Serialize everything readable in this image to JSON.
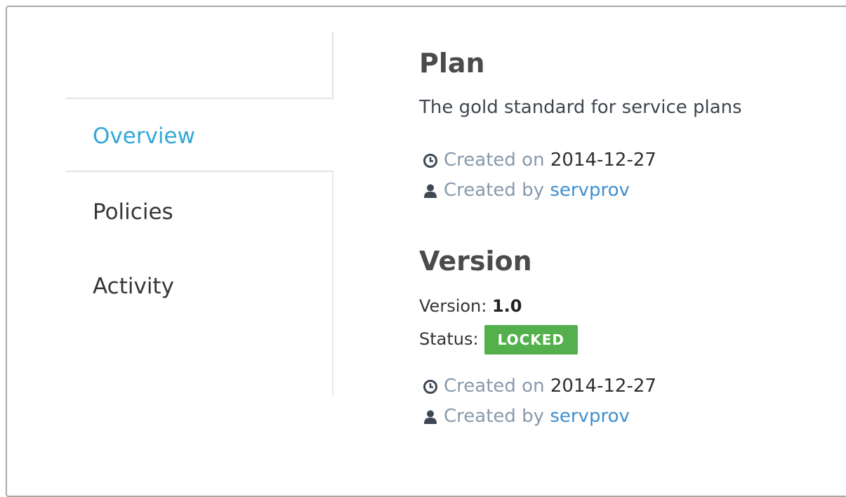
{
  "nav": {
    "items": [
      {
        "label": "Overview",
        "active": true
      },
      {
        "label": "Policies",
        "active": false
      },
      {
        "label": "Activity",
        "active": false
      }
    ]
  },
  "plan": {
    "heading": "Plan",
    "description": "The gold standard for service plans",
    "created_on_label": "Created on",
    "created_on_value": "2014-12-27",
    "created_by_label": "Created by",
    "created_by_value": "servprov"
  },
  "version": {
    "heading": "Version",
    "version_label": "Version:",
    "version_value": "1.0",
    "status_label": "Status:",
    "status_value": "LOCKED",
    "created_on_label": "Created on",
    "created_on_value": "2014-12-27",
    "created_by_label": "Created by",
    "created_by_value": "servprov"
  },
  "icons": {
    "clock": "clock-icon",
    "user": "user-icon"
  },
  "colors": {
    "accent": "#31a8d9",
    "link": "#3f8fcf",
    "status_locked": "#53b04c",
    "muted": "#889aac"
  }
}
